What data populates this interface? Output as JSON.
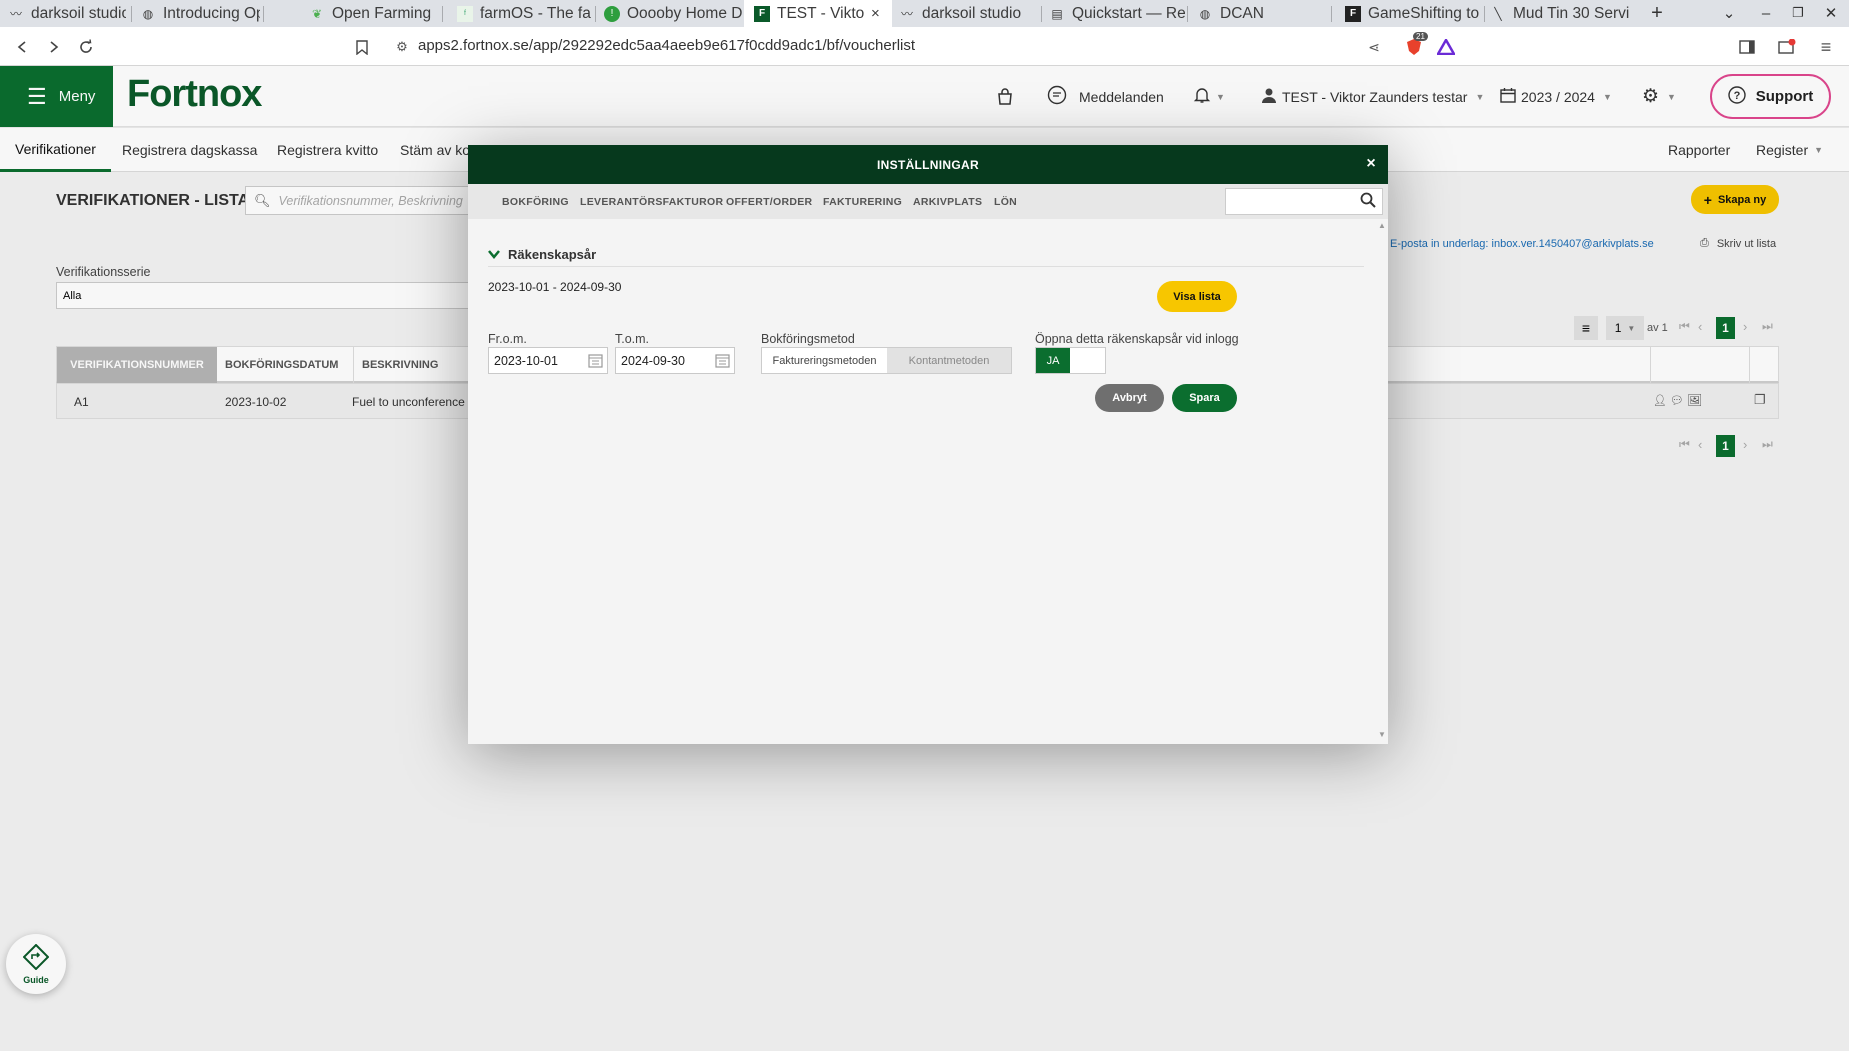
{
  "browser": {
    "tabs": [
      {
        "title": "darksoil studio",
        "icon": "darksoil-icon"
      },
      {
        "title": "Introducing Ope",
        "icon": "globe-icon"
      },
      {
        "title": "Open Farming",
        "icon": "leaf-icon"
      },
      {
        "title": "farmOS - The fa",
        "icon": "farmos-icon"
      },
      {
        "title": "Ooooby Home D",
        "icon": "ooooby-icon"
      },
      {
        "title": "TEST - Viktor",
        "icon": "fortnox-icon",
        "active": true
      },
      {
        "title": "darksoil studio",
        "icon": "darksoil-icon"
      },
      {
        "title": "Quickstart — Re",
        "icon": "book-icon"
      },
      {
        "title": "DCAN",
        "icon": "globe-icon"
      },
      {
        "title": "GameShifting to",
        "icon": "gameshifting-icon"
      },
      {
        "title": "Mud Tin 30 Servi",
        "icon": "mudtin-icon"
      }
    ],
    "url": "apps2.fortnox.se/app/292292edc5aa4aeeb9e617f0cdd9adc1/bf/voucherlist",
    "shield_badge": "21"
  },
  "header": {
    "menu_label": "Meny",
    "logo_text": "Fortnox",
    "messages_label": "Meddelanden",
    "user_label": "TEST - Viktor Zaunders testar",
    "year_label": "2023 / 2024",
    "support_label": "Support"
  },
  "subnav": {
    "items": [
      "Verifikationer",
      "Registrera dagskassa",
      "Registrera kvitto",
      "Stäm av kon"
    ],
    "right_items": [
      "Rapporter",
      "Register"
    ]
  },
  "page": {
    "title": "VERIFIKATIONER - LISTA",
    "search_placeholder": "Verifikationsnummer, Beskrivning",
    "create_label": "Skapa ny",
    "email_note": "E-posta in underlag: inbox.ver.1450407@arkivplats.se",
    "print_label": "Skriv ut lista",
    "series_label": "Verifikationsserie",
    "series_value": "Alla",
    "pager": {
      "per_page": "1",
      "of_label": "av 1",
      "current": "1"
    },
    "columns": [
      "VERIFIKATIONSNUMMER",
      "BOKFÖRINGSDATUM",
      "BESKRIVNING"
    ],
    "rows": [
      {
        "number": "A1",
        "date": "2023-10-02",
        "description": "Fuel to unconference a"
      }
    ],
    "guide_label": "Guide"
  },
  "modal": {
    "title": "INSTÄLLNINGAR",
    "tabs": [
      "BOKFÖRING",
      "LEVERANTÖRSFAKTUROR",
      "OFFERT/ORDER",
      "FAKTURERING",
      "ARKIVPLATS",
      "LÖN"
    ],
    "section_title": "Räkenskapsår",
    "year_range": "2023-10-01 - 2024-09-30",
    "show_list_label": "Visa lista",
    "from_label": "Fr.o.m.",
    "from_value": "2023-10-01",
    "to_label": "T.o.m.",
    "to_value": "2024-09-30",
    "method_label": "Bokföringsmetod",
    "method_options": [
      "Faktureringsmetoden",
      "Kontantmetoden"
    ],
    "open_label": "Öppna detta räkenskapsår vid inlogg",
    "toggle_yes": "JA",
    "cancel_label": "Avbryt",
    "save_label": "Spara"
  },
  "colors": {
    "brand_green": "#0b6e2f",
    "modal_header": "#06391d",
    "accent_yellow": "#f7c600",
    "support_pink": "#e0478f"
  }
}
